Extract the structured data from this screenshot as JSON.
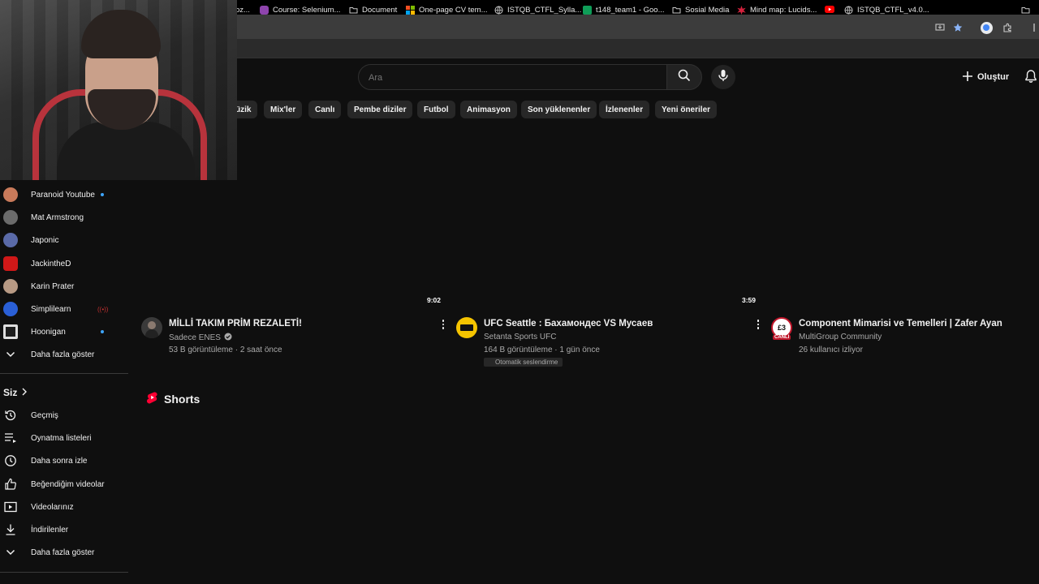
{
  "browser": {
    "bookmarks": [
      {
        "label": "oz...",
        "icon": "globe-icon"
      },
      {
        "label": "Course: Selenium...",
        "icon": "course-icon"
      },
      {
        "label": "Document",
        "icon": "folder-icon"
      },
      {
        "label": "One-page CV tem...",
        "icon": "microsoft-icon"
      },
      {
        "label": "ISTQB_CTFL_Sylla...",
        "icon": "globe-icon"
      },
      {
        "label": "t148_team1 - Goo...",
        "icon": "sheets-icon"
      },
      {
        "label": "Sosial Media",
        "icon": "folder-icon"
      },
      {
        "label": "Mind map: Lucids...",
        "icon": "lucid-icon"
      },
      {
        "label": "",
        "icon": "youtube-icon"
      },
      {
        "label": "ISTQB_CTFL_v4.0...",
        "icon": "globe-icon"
      }
    ]
  },
  "header": {
    "search_placeholder": "Ara",
    "create_label": "Oluştur"
  },
  "chips": [
    "üzik",
    "Mix'ler",
    "Canlı",
    "Pembe diziler",
    "Futbol",
    "Animasyon",
    "Son yüklenenler",
    "İzlenenler",
    "Yeni öneriler"
  ],
  "sidebar": {
    "subscriptions": [
      {
        "label": "Paranoid Youtube",
        "avatar_color": "#c97a5a",
        "live": true
      },
      {
        "label": "Mat Armstrong",
        "avatar_color": "#6b6b6b",
        "live": false
      },
      {
        "label": "Japonic",
        "avatar_color": "#5a6aa8",
        "live": false
      },
      {
        "label": "JackintheD",
        "avatar_color": "#d01818",
        "live": false
      },
      {
        "label": "Karin Prater",
        "avatar_color": "#b89a84",
        "live": false
      },
      {
        "label": "Simplilearn",
        "avatar_color": "#2a5fd6",
        "live": false,
        "live_icon": true
      },
      {
        "label": "Hoonigan",
        "avatar_color": "#222222",
        "live": true
      },
      {
        "label": "Daha fazla göster",
        "icon": "chevron-down-icon"
      }
    ],
    "you_section": {
      "title": "Siz",
      "items": [
        {
          "label": "Geçmiş",
          "icon": "history-icon"
        },
        {
          "label": "Oynatma listeleri",
          "icon": "playlist-icon"
        },
        {
          "label": "Daha sonra izle",
          "icon": "clock-icon"
        },
        {
          "label": "Beğendiğim videolar",
          "icon": "thumbs-up-icon"
        },
        {
          "label": "Videolarınız",
          "icon": "your-videos-icon"
        },
        {
          "label": "İndirilenler",
          "icon": "download-icon"
        },
        {
          "label": "Daha fazla göster",
          "icon": "chevron-down-icon"
        }
      ]
    }
  },
  "videos": [
    {
      "title": "MİLLİ TAKIM PRİM REZALETİ!",
      "channel": "Sadece ENES",
      "verified": true,
      "meta": "53 B görüntüleme · 2 saat önce",
      "duration": "",
      "avatar_color": "#444"
    },
    {
      "title": "UFC Seattle : Бахамондес VS Мусаев",
      "channel": "Setanta Sports UFC",
      "verified": false,
      "meta": "164 B görüntüleme · 1 gün önce",
      "duration": "9:02",
      "badge": "Otomatik seslendirme",
      "avatar_color": "#f5c400"
    },
    {
      "title": "Component Mimarisi ve Temelleri | Zafer Ayan",
      "channel": "MultiGroup Community",
      "verified": false,
      "meta": "26 kullanıcı izliyor",
      "duration": "3:59",
      "avatar_color": "#c0162a",
      "live_label": "CANLI"
    }
  ],
  "shorts": {
    "title": "Shorts"
  }
}
